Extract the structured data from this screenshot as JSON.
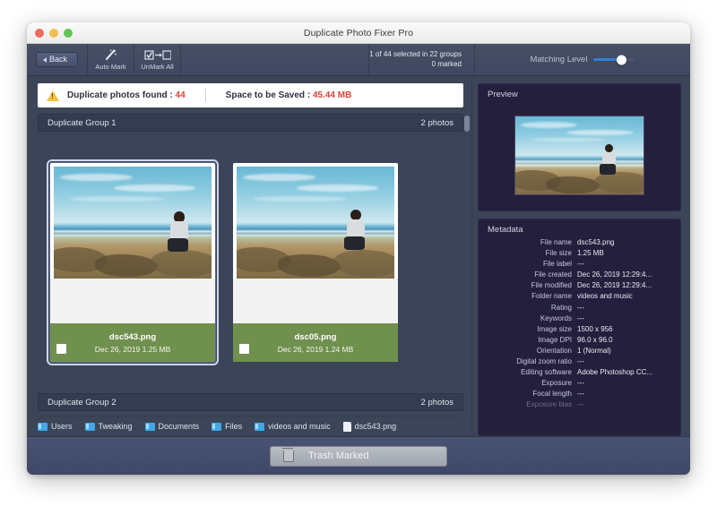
{
  "window": {
    "title": "Duplicate Photo Fixer Pro",
    "traffic_lights": [
      "close-button",
      "minimize-button",
      "zoom-button"
    ]
  },
  "toolbar": {
    "back_label": "Back",
    "auto_mark_label": "Auto Mark",
    "unmark_all_label": "UnMark All",
    "status_line1": "1 of 44 selected in 22 groups",
    "status_line2": "0 marked",
    "matching_level_label": "Matching Level",
    "matching_level_value": 62
  },
  "alert": {
    "found_label": "Duplicate photos found : ",
    "found_count": "44",
    "saved_label": "Space to be Saved : ",
    "saved_value": "45.44 MB"
  },
  "groups": [
    {
      "title": "Duplicate Group 1",
      "count_label": "2 photos",
      "photos": [
        {
          "name": "dsc543.png",
          "meta": "Dec 26, 2019 1.25 MB",
          "selected": true,
          "checked": false
        },
        {
          "name": "dsc05.png",
          "meta": "Dec 26, 2019 1.24 MB",
          "selected": false,
          "checked": false
        }
      ]
    },
    {
      "title": "Duplicate Group 2",
      "count_label": "2 photos"
    }
  ],
  "breadcrumb": [
    {
      "label": "Users",
      "icon": "folder-icon"
    },
    {
      "label": "Tweaking",
      "icon": "folder-icon"
    },
    {
      "label": "Documents",
      "icon": "folder-icon"
    },
    {
      "label": "Files",
      "icon": "folder-icon"
    },
    {
      "label": "videos and music",
      "icon": "folder-icon"
    },
    {
      "label": "dsc543.png",
      "icon": "file-icon"
    }
  ],
  "preview": {
    "title": "Preview"
  },
  "metadata": {
    "title": "Metadata",
    "rows": [
      {
        "key": "File name",
        "value": "dsc543.png"
      },
      {
        "key": "File size",
        "value": "1.25 MB"
      },
      {
        "key": "File label",
        "value": "---"
      },
      {
        "key": "File created",
        "value": "Dec 26, 2019 12:29:4..."
      },
      {
        "key": "File modified",
        "value": "Dec 26, 2019 12:29:4..."
      },
      {
        "key": "Folder name",
        "value": "videos and music"
      },
      {
        "key": "Rating",
        "value": "---"
      },
      {
        "key": "Keywords",
        "value": "---"
      },
      {
        "key": "Image size",
        "value": "1500 x 956"
      },
      {
        "key": "Image DPI",
        "value": "96.0 x 96.0"
      },
      {
        "key": "Orientation",
        "value": "1 (Normal)"
      },
      {
        "key": "Digital zoom ratio",
        "value": "---"
      },
      {
        "key": "Editing software",
        "value": "Adobe Photoshop CC..."
      },
      {
        "key": "Exposure",
        "value": "---"
      },
      {
        "key": "Focal length",
        "value": "---"
      },
      {
        "key": "Exposure bias",
        "value": "---"
      }
    ]
  },
  "footer": {
    "trash_label": "Trash Marked"
  },
  "colors": {
    "accent_blue": "#2f7fd8",
    "alert_red": "#d94436",
    "thumb_green": "#70904e",
    "window_bg": "#3c4558",
    "panel_bg": "#241f3d"
  }
}
